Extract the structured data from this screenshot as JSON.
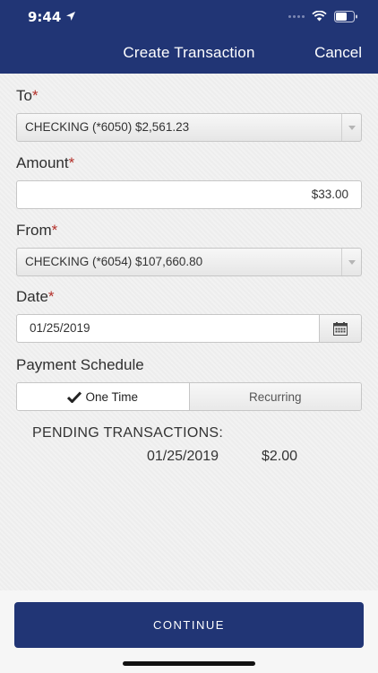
{
  "status_bar": {
    "time": "9:44"
  },
  "nav": {
    "title": "Create Transaction",
    "cancel": "Cancel"
  },
  "form": {
    "to": {
      "label": "To",
      "required_mark": "*",
      "value": "CHECKING (*6050) $2,561.23"
    },
    "amount": {
      "label": "Amount",
      "required_mark": "*",
      "value": "$33.00"
    },
    "from": {
      "label": "From",
      "required_mark": "*",
      "value": "CHECKING (*6054) $107,660.80"
    },
    "date": {
      "label": "Date",
      "required_mark": "*",
      "value": "01/25/2019"
    },
    "schedule": {
      "label": "Payment Schedule",
      "options": [
        "One Time",
        "Recurring"
      ],
      "selected": "One Time"
    }
  },
  "pending": {
    "title": "PENDING TRANSACTIONS:",
    "items": [
      {
        "date": "01/25/2019",
        "amount": "$2.00"
      }
    ]
  },
  "continue_label": "CONTINUE",
  "colors": {
    "brand": "#213575",
    "required": "#b3302a"
  }
}
